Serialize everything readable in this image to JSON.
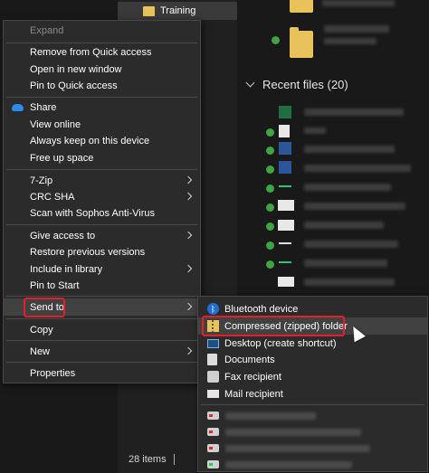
{
  "explorer": {
    "nav_training_label": "Training",
    "section_title": "Recent files (20)",
    "status_items": "28 items"
  },
  "context_menu": {
    "items": [
      {
        "label": "Expand",
        "disabled": true
      },
      {
        "label": "Remove from Quick access"
      },
      {
        "label": "Open in new window"
      },
      {
        "label": "Pin to Quick access"
      },
      {
        "label": "Share",
        "icon": "onedrive-icon"
      },
      {
        "label": "View online"
      },
      {
        "label": "Always keep on this device"
      },
      {
        "label": "Free up space"
      },
      {
        "label": "7-Zip",
        "submenu": true
      },
      {
        "label": "CRC SHA",
        "submenu": true
      },
      {
        "label": "Scan with Sophos Anti-Virus"
      },
      {
        "label": "Give access to",
        "submenu": true
      },
      {
        "label": "Restore previous versions"
      },
      {
        "label": "Include in library",
        "submenu": true
      },
      {
        "label": "Pin to Start"
      },
      {
        "label": "Send to",
        "submenu": true,
        "highlighted": true
      },
      {
        "label": "Copy"
      },
      {
        "label": "New",
        "submenu": true
      },
      {
        "label": "Properties"
      }
    ]
  },
  "send_to_menu": {
    "items": [
      {
        "label": "Bluetooth device",
        "icon": "bluetooth-icon"
      },
      {
        "label": "Compressed (zipped) folder",
        "icon": "zip-folder-icon",
        "highlighted": true
      },
      {
        "label": "Desktop (create shortcut)",
        "icon": "desktop-icon"
      },
      {
        "label": "Documents",
        "icon": "documents-icon"
      },
      {
        "label": "Fax recipient",
        "icon": "fax-icon"
      },
      {
        "label": "Mail recipient",
        "icon": "mail-icon"
      }
    ]
  },
  "colors": {
    "menu_bg": "#2b2b2b",
    "highlight": "#414141",
    "annotation_red": "#e41f2b",
    "explorer_bg": "#191919"
  }
}
